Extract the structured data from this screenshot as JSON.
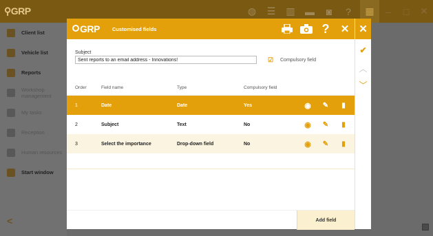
{
  "app": {
    "logo": "GRP",
    "sidebar": [
      {
        "label": "Client list",
        "dim": false
      },
      {
        "label": "Vehicle list",
        "dim": false
      },
      {
        "label": "Reports",
        "dim": false
      },
      {
        "label": "Workshop management",
        "dim": true
      },
      {
        "label": "My tasks",
        "dim": true
      },
      {
        "label": "Reception",
        "dim": true
      },
      {
        "label": "Human resources",
        "dim": true
      },
      {
        "label": "Start window",
        "dim": false
      }
    ],
    "back_icon": "<"
  },
  "dialog": {
    "logo": "GRP",
    "title": "Customised fields",
    "subject_label": "Subject",
    "subject_value": "Sent reports to an email address - Innovations!",
    "compulsory_label": "Compulsory field",
    "compulsory_checked": true,
    "columns": {
      "order": "Order",
      "name": "Field name",
      "type": "Type",
      "compulsory": "Compulsory field"
    },
    "rows": [
      {
        "order": "1",
        "name": "Date",
        "type": "Date",
        "compulsory": "Yes"
      },
      {
        "order": "2",
        "name": "Subject",
        "type": "Text",
        "compulsory": "No"
      },
      {
        "order": "3",
        "name": "Select the importance",
        "type": "Drop-down field",
        "compulsory": "No"
      }
    ],
    "add_button": "Add field",
    "help_glyph": "?",
    "close_glyph": "✕"
  },
  "colors": {
    "accent": "#e3a00b",
    "row_alt": "#fbf4e0"
  }
}
